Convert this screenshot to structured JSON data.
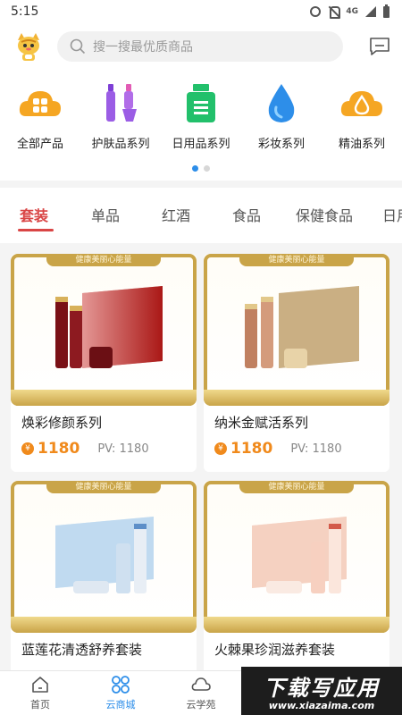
{
  "status_bar": {
    "time": "5:15",
    "network": "4G"
  },
  "search": {
    "placeholder": "搜一搜最优质商品"
  },
  "categories": [
    {
      "label": "全部产品",
      "icon": "grid-cloud-icon",
      "color": "#f5a623"
    },
    {
      "label": "护肤品系列",
      "icon": "skincare-bottles-icon",
      "color": "#9b5de5"
    },
    {
      "label": "日用品系列",
      "icon": "daily-bottle-icon",
      "color": "#22c06b"
    },
    {
      "label": "彩妆系列",
      "icon": "water-drop-icon",
      "color": "#2d8ee9"
    },
    {
      "label": "精油系列",
      "icon": "oil-cloud-icon",
      "color": "#f5a623"
    }
  ],
  "tabs": [
    "套装",
    "单品",
    "红酒",
    "食品",
    "保健食品",
    "日用"
  ],
  "active_tab": "套装",
  "products": [
    {
      "banner": "健康美丽心能量",
      "name": "焕彩修颜系列",
      "price": "1180",
      "pv": "PV: 1180",
      "box_color": "#c9302c"
    },
    {
      "banner": "健康美丽心能量",
      "name": "纳米金赋活系列",
      "price": "1180",
      "pv": "PV: 1180",
      "box_color": "#b8945a"
    },
    {
      "banner": "健康美丽心能量",
      "name": "蓝莲花清透舒养套装",
      "name_short": "蓝莲花清透舒养套装",
      "price": "",
      "pv": "",
      "box_color": "#9fc7e8"
    },
    {
      "banner": "健康美丽心能量",
      "name": "火棘果珍润滋养套装",
      "price": "",
      "pv": "",
      "box_color": "#f0b8a0"
    }
  ],
  "bottom_nav": [
    {
      "label": "首页",
      "icon": "home-icon"
    },
    {
      "label": "云商城",
      "icon": "store-grid-icon"
    },
    {
      "label": "云学苑",
      "icon": "cloud-academy-icon"
    }
  ],
  "active_nav": "云商城",
  "watermark": {
    "main": "下载写应用",
    "sub": "www.xiazaima.com"
  },
  "colors": {
    "accent": "#2d8ee9",
    "price": "#f08a1c",
    "active_tab": "#d94545",
    "gold": "#c9a448"
  }
}
